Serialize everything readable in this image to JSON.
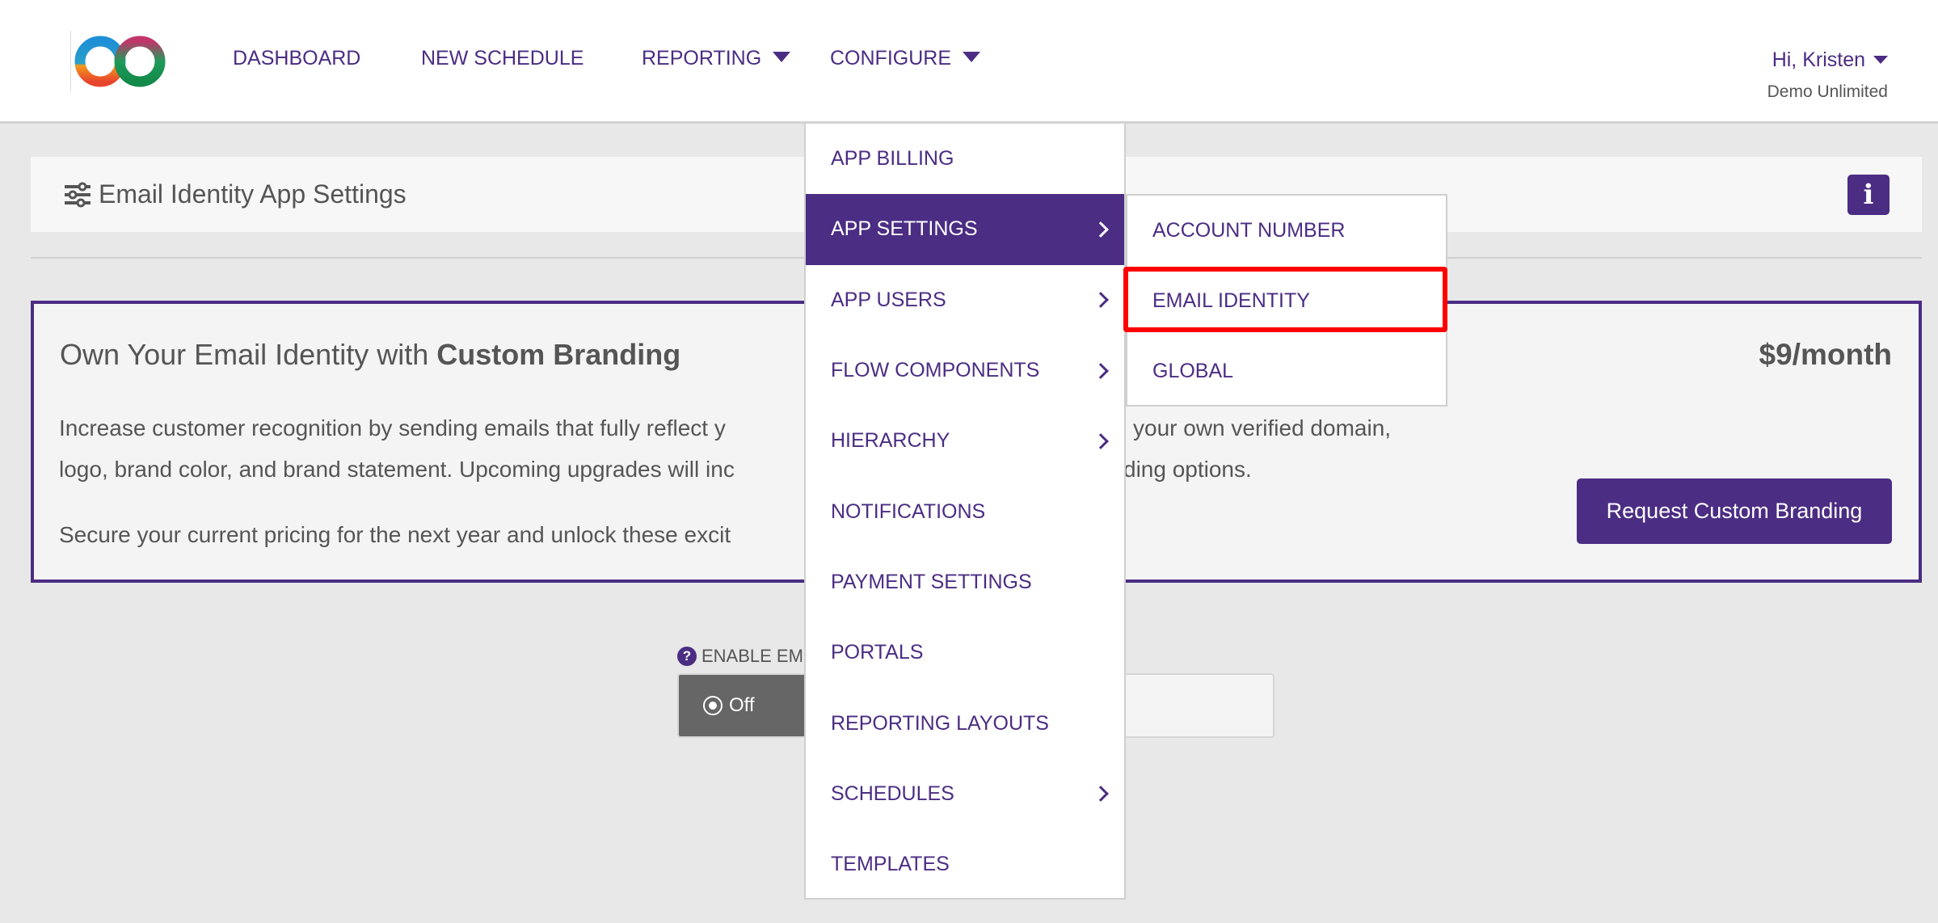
{
  "header": {
    "nav": [
      {
        "label": "DASHBOARD",
        "has_dropdown": false
      },
      {
        "label": "NEW SCHEDULE",
        "has_dropdown": false
      },
      {
        "label": "REPORTING",
        "has_dropdown": true
      },
      {
        "label": "CONFIGURE",
        "has_dropdown": true
      }
    ],
    "user_greeting": "Hi, Kristen",
    "org_name": "Demo Unlimited"
  },
  "settings_bar": {
    "icon": "sliders-icon",
    "title": "Email Identity App Settings",
    "info_icon": "info-icon"
  },
  "promo": {
    "title_prefix": "Own Your Email Identity with ",
    "title_bold": "Custom Branding",
    "price": "$9/month",
    "line1_left": "Increase customer recognition by sending emails that fully reflect y",
    "line1_right": "your own verified domain,",
    "line2_left": "logo, brand color, and brand statement. Upcoming upgrades will inc",
    "line2_right": "ding options.",
    "line3_left": "Secure your current pricing for the next year and unlock these excit",
    "button_label": "Request Custom Branding"
  },
  "enable": {
    "label": "ENABLE EM",
    "toggle_off": "Off",
    "selected": "Off"
  },
  "configure_menu": {
    "items": [
      {
        "label": "APP BILLING",
        "submenu": false
      },
      {
        "label": "APP SETTINGS",
        "submenu": true,
        "active": true
      },
      {
        "label": "APP USERS",
        "submenu": true
      },
      {
        "label": "FLOW COMPONENTS",
        "submenu": true
      },
      {
        "label": "HIERARCHY",
        "submenu": true
      },
      {
        "label": "NOTIFICATIONS",
        "submenu": false
      },
      {
        "label": "PAYMENT SETTINGS",
        "submenu": false
      },
      {
        "label": "PORTALS",
        "submenu": false
      },
      {
        "label": "REPORTING LAYOUTS",
        "submenu": false
      },
      {
        "label": "SCHEDULES",
        "submenu": true
      },
      {
        "label": "TEMPLATES",
        "submenu": false
      }
    ]
  },
  "app_settings_submenu": {
    "items": [
      {
        "label": "ACCOUNT NUMBER"
      },
      {
        "label": "EMAIL IDENTITY",
        "highlighted": true
      },
      {
        "label": "GLOBAL"
      }
    ]
  },
  "colors": {
    "brand_purple": "#4b2d83",
    "highlight_red": "#ff0000",
    "toggle_off_bg": "#666666"
  }
}
